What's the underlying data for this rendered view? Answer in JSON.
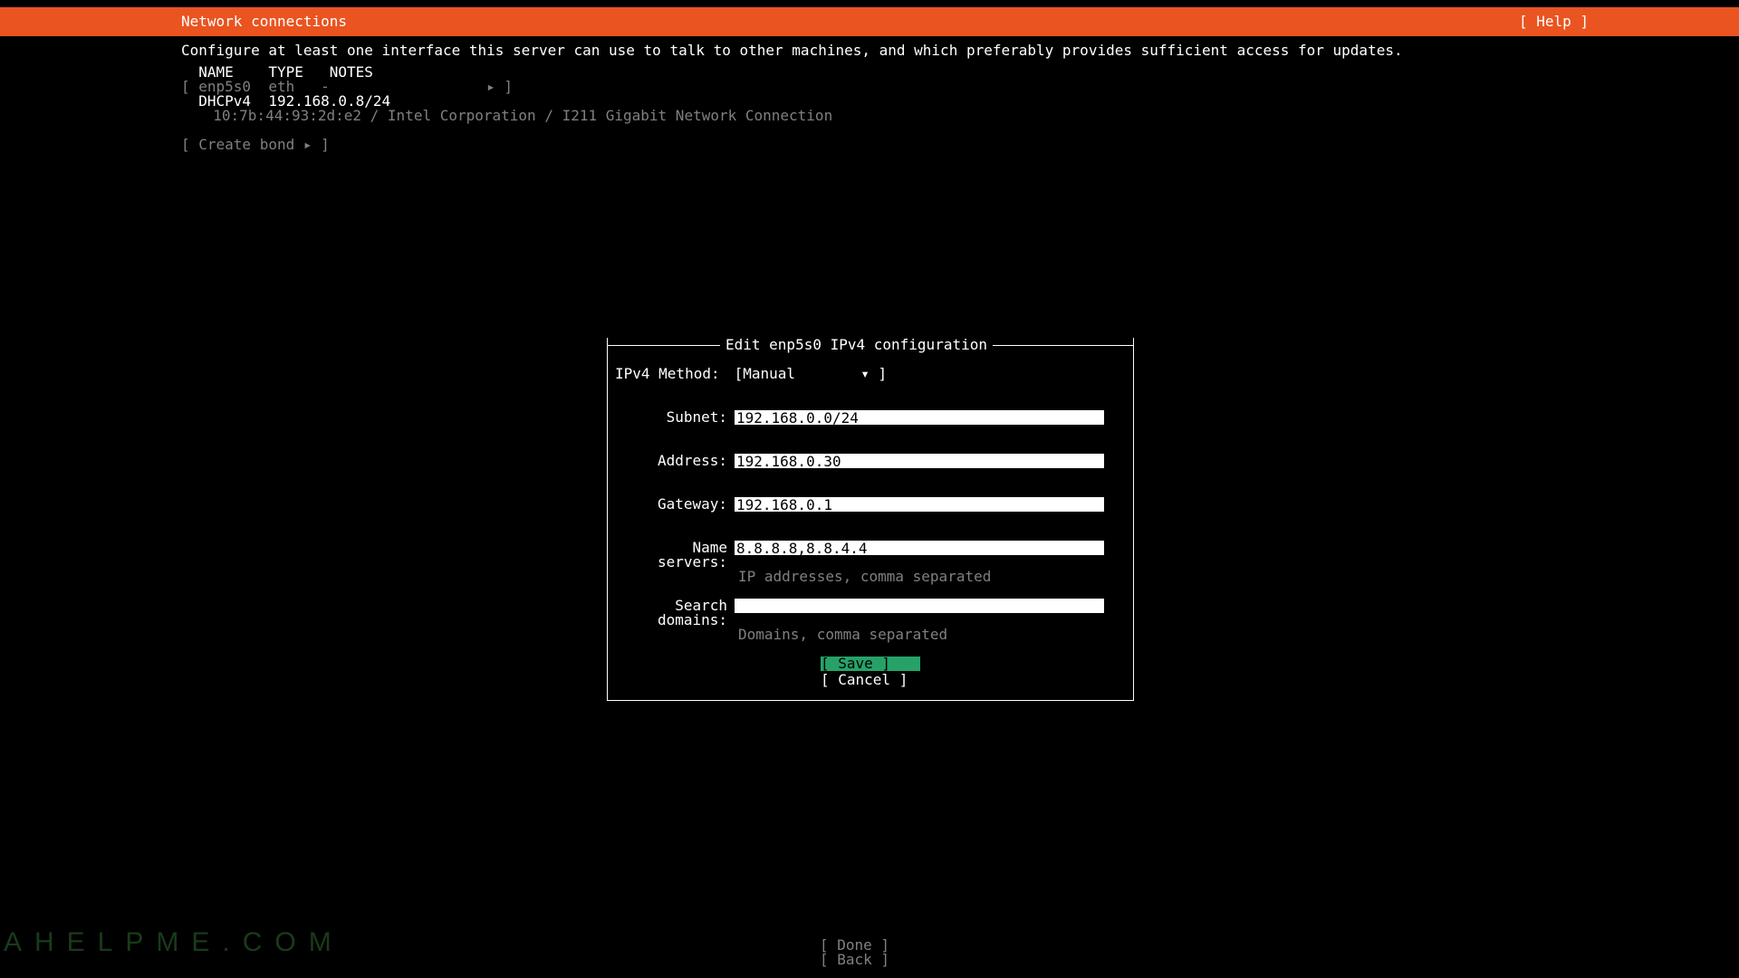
{
  "header": {
    "title": "Network connections",
    "help_label": "[ Help ]"
  },
  "description": "Configure at least one interface this server can use to talk to other machines, and which preferably provides sufficient access for updates.",
  "iface_header": {
    "name": "NAME",
    "type": "TYPE",
    "notes": "NOTES"
  },
  "iface_list": {
    "line1": "[ enp5s0  eth   -                  ▸ ]",
    "line2": "  DHCPv4  192.168.0.8/24",
    "line3": "  10:7b:44:93:2d:e2 / Intel Corporation / I211 Gigabit Network Connection"
  },
  "create_bond": "[ Create bond ▸ ]",
  "dialog": {
    "title": " Edit enp5s0 IPv4 configuration ",
    "method_label": "IPv4 Method:",
    "method_value": "Manual",
    "subnet_label": "Subnet:",
    "subnet_value": "192.168.0.0/24",
    "address_label": "Address:",
    "address_value": "192.168.0.30",
    "gateway_label": "Gateway:",
    "gateway_value": "192.168.0.1",
    "ns_label": "Name servers:",
    "ns_value": "8.8.8.8,8.8.4.4",
    "ns_hint": "IP addresses, comma separated",
    "sd_label": "Search domains:",
    "sd_value": "",
    "sd_hint": "Domains, comma separated",
    "save_label": "[ Save       ]",
    "cancel_label": "[ Cancel     ]"
  },
  "footer": {
    "done_label": "[ Done       ]",
    "back_label": "[ Back       ]"
  },
  "watermark": "AHELPME.COM"
}
